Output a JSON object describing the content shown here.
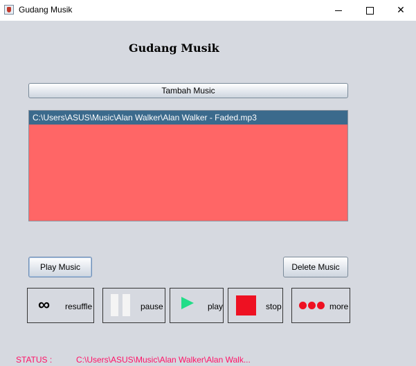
{
  "window": {
    "title": "Gudang Musik",
    "controls": {
      "minimize": "—",
      "maximize": "☐",
      "close": "✕"
    }
  },
  "heading": "Gudang Musik",
  "buttons": {
    "add_music": "Tambah Music",
    "play_music": "Play Music",
    "delete_music": "Delete Music"
  },
  "playlist": {
    "items": [
      "C:\\Users\\ASUS\\Music\\Alan Walker\\Alan Walker - Faded.mp3"
    ],
    "selected_index": 0,
    "background_color": "#ff6666",
    "selection_color": "#3b6a8c"
  },
  "controls": [
    {
      "icon": "infinity-icon",
      "label": "resuffle"
    },
    {
      "icon": "pause-icon",
      "label": "pause"
    },
    {
      "icon": "play-icon",
      "label": "play"
    },
    {
      "icon": "stop-icon",
      "label": "stop"
    },
    {
      "icon": "more-icon",
      "label": "more"
    }
  ],
  "status": {
    "label": "STATUS :",
    "value": "C:\\Users\\ASUS\\Music\\Alan Walker\\Alan Walk...",
    "color": "#ff1166"
  }
}
